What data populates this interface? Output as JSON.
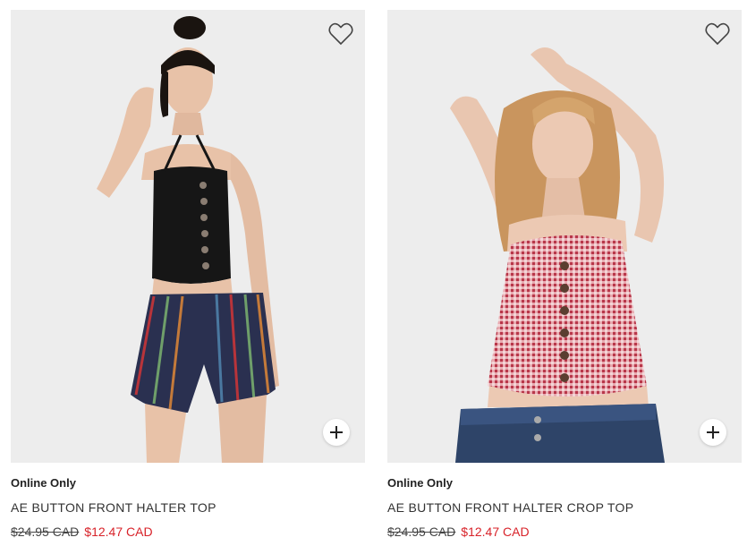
{
  "products": [
    {
      "badge": "Online Only",
      "name": "AE BUTTON FRONT HALTER TOP",
      "original_price": "$24.95 CAD",
      "sale_price": "$12.47 CAD",
      "wishlist_icon": "heart-outline-icon",
      "add_icon": "plus-icon"
    },
    {
      "badge": "Online Only",
      "name": "AE BUTTON FRONT HALTER CROP TOP",
      "original_price": "$24.95 CAD",
      "sale_price": "$12.47 CAD",
      "wishlist_icon": "heart-outline-icon",
      "add_icon": "plus-icon"
    }
  ],
  "colors": {
    "sale": "#d8232a",
    "image_background": "#ededed",
    "text": "#333333"
  }
}
